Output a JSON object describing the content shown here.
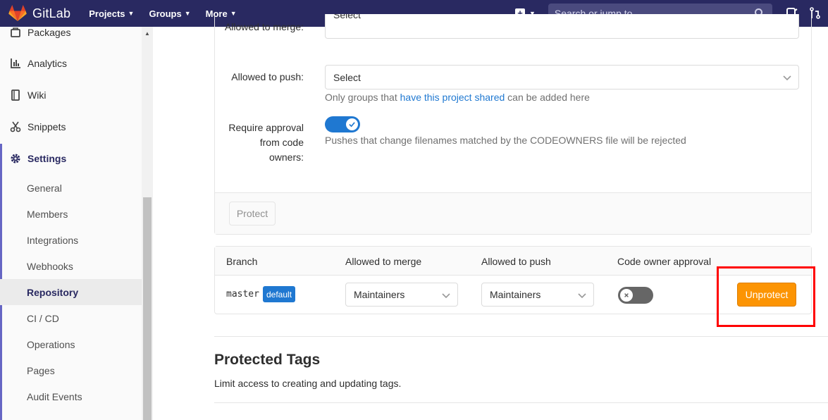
{
  "navbar": {
    "brand": "GitLab",
    "menu": [
      {
        "label": "Projects"
      },
      {
        "label": "Groups"
      },
      {
        "label": "More"
      }
    ],
    "search_placeholder": "Search or jump to..."
  },
  "sidebar": {
    "items": [
      {
        "label": "Packages",
        "icon": "package-icon"
      },
      {
        "label": "Analytics",
        "icon": "chart-icon"
      },
      {
        "label": "Wiki",
        "icon": "book-icon"
      },
      {
        "label": "Snippets",
        "icon": "scissors-icon"
      },
      {
        "label": "Settings",
        "icon": "gear-icon"
      }
    ],
    "sub_items": [
      {
        "label": "General"
      },
      {
        "label": "Members"
      },
      {
        "label": "Integrations"
      },
      {
        "label": "Webhooks"
      },
      {
        "label": "Repository"
      },
      {
        "label": "CI / CD"
      },
      {
        "label": "Operations"
      },
      {
        "label": "Pages"
      },
      {
        "label": "Audit Events"
      }
    ]
  },
  "form": {
    "allowed_to_merge_label": "Allowed to merge:",
    "allowed_to_merge_value": "Select",
    "allowed_to_push_label": "Allowed to push:",
    "allowed_to_push_value": "Select",
    "push_help_prefix": "Only groups that",
    "push_help_link": "have this project shared",
    "push_help_suffix": "can be added here",
    "code_owner_label": "Require approval from code owners:",
    "code_owner_enabled": true,
    "code_owner_help": "Pushes that change filenames matched by the CODEOWNERS file will be rejected",
    "protect_button": "Protect"
  },
  "table": {
    "headers": [
      "Branch",
      "Allowed to merge",
      "Allowed to push",
      "Code owner approval"
    ],
    "rows": [
      {
        "branch": "master",
        "badge": "default",
        "allowed_to_merge": "Maintainers",
        "allowed_to_push": "Maintainers",
        "code_owner_approval": false,
        "action": "Unprotect"
      }
    ]
  },
  "protected_tags": {
    "title": "Protected Tags",
    "description": "Limit access to creating and updating tags."
  },
  "colors": {
    "navbar": "#292961",
    "accent_blue": "#1f78d1",
    "unprotect_orange": "#fc9403",
    "highlight_red": "#ff0000"
  }
}
